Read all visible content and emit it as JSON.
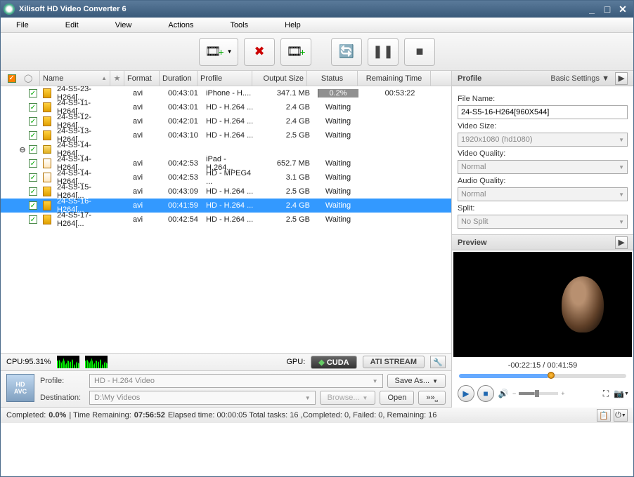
{
  "app": {
    "title": "Xilisoft HD Video Converter 6"
  },
  "menu": {
    "file": "File",
    "edit": "Edit",
    "view": "View",
    "actions": "Actions",
    "tools": "Tools",
    "help": "Help"
  },
  "columns": {
    "name": "Name",
    "format": "Format",
    "duration": "Duration",
    "profile": "Profile",
    "output_size": "Output Size",
    "status": "Status",
    "remaining": "Remaining Time"
  },
  "rows": [
    {
      "indent": 0,
      "icon": "film",
      "name": "24-S5-23-H264[...",
      "format": "avi",
      "duration": "00:43:01",
      "profile": "iPhone - H....",
      "size": "347.1 MB",
      "status_type": "progress",
      "status": "0.2%",
      "remaining": "00:53:22"
    },
    {
      "indent": 0,
      "icon": "film",
      "name": "24-S5-11-H264[...",
      "format": "avi",
      "duration": "00:43:01",
      "profile": "HD - H.264 ...",
      "size": "2.4 GB",
      "status_type": "text",
      "status": "Waiting",
      "remaining": ""
    },
    {
      "indent": 0,
      "icon": "film",
      "name": "24-S5-12-H264[...",
      "format": "avi",
      "duration": "00:42:01",
      "profile": "HD - H.264 ...",
      "size": "2.4 GB",
      "status_type": "text",
      "status": "Waiting",
      "remaining": ""
    },
    {
      "indent": 0,
      "icon": "film",
      "name": "24-S5-13-H264[...",
      "format": "avi",
      "duration": "00:43:10",
      "profile": "HD - H.264 ...",
      "size": "2.5 GB",
      "status_type": "text",
      "status": "Waiting",
      "remaining": ""
    },
    {
      "indent": 0,
      "toggle": "-",
      "icon": "folder",
      "name": "24-S5-14-H264[...",
      "format": "",
      "duration": "",
      "profile": "",
      "size": "",
      "status_type": "none",
      "status": "",
      "remaining": ""
    },
    {
      "indent": 1,
      "icon": "doc",
      "name": "24-S5-14-H264[...",
      "format": "avi",
      "duration": "00:42:53",
      "profile": "iPad - H.264...",
      "size": "652.7 MB",
      "status_type": "text",
      "status": "Waiting",
      "remaining": ""
    },
    {
      "indent": 1,
      "icon": "doc",
      "name": "24-S5-14-H264[...",
      "format": "avi",
      "duration": "00:42:53",
      "profile": "HD - MPEG4 ...",
      "size": "3.1 GB",
      "status_type": "text",
      "status": "Waiting",
      "remaining": ""
    },
    {
      "indent": 0,
      "icon": "film",
      "name": "24-S5-15-H264[...",
      "format": "avi",
      "duration": "00:43:09",
      "profile": "HD - H.264 ...",
      "size": "2.5 GB",
      "status_type": "text",
      "status": "Waiting",
      "remaining": ""
    },
    {
      "indent": 0,
      "selected": true,
      "icon": "film",
      "name": "24-S5-16-H264[...",
      "format": "avi",
      "duration": "00:41:59",
      "profile": "HD - H.264 ...",
      "size": "2.4 GB",
      "status_type": "text",
      "status": "Waiting",
      "remaining": ""
    },
    {
      "indent": 0,
      "icon": "film",
      "name": "24-S5-17-H264[...",
      "format": "avi",
      "duration": "00:42:54",
      "profile": "HD - H.264 ...",
      "size": "2.5 GB",
      "status_type": "text",
      "status": "Waiting",
      "remaining": ""
    }
  ],
  "profile_panel": {
    "title": "Profile",
    "basic": "Basic Settings ▼",
    "file_name_label": "File Name:",
    "file_name": "24-S5-16-H264[960X544]",
    "video_size_label": "Video Size:",
    "video_size": "1920x1080 (hd1080)",
    "video_quality_label": "Video Quality:",
    "video_quality": "Normal",
    "audio_quality_label": "Audio Quality:",
    "audio_quality": "Normal",
    "split_label": "Split:",
    "split": "No Split"
  },
  "preview": {
    "title": "Preview",
    "time": "-00:22:15 / 00:41:59"
  },
  "cpu": {
    "label": "CPU:95.31%",
    "gpu": "GPU:",
    "cuda": "CUDA",
    "ati": "ATI STREAM"
  },
  "bottom": {
    "profile_label": "Profile:",
    "profile_value": "HD - H.264 Video",
    "saveas": "Save As...",
    "dest_label": "Destination:",
    "dest_value": "D:\\My Videos",
    "browse": "Browse...",
    "open": "Open"
  },
  "status": {
    "completed_label": "Completed: ",
    "completed": "0.0%",
    "remaining_label": " | Time Remaining: ",
    "remaining": "07:56:52",
    "rest": " Elapsed time: 00:00:05 Total tasks: 16 ,Completed: 0, Failed: 0, Remaining: 16"
  }
}
